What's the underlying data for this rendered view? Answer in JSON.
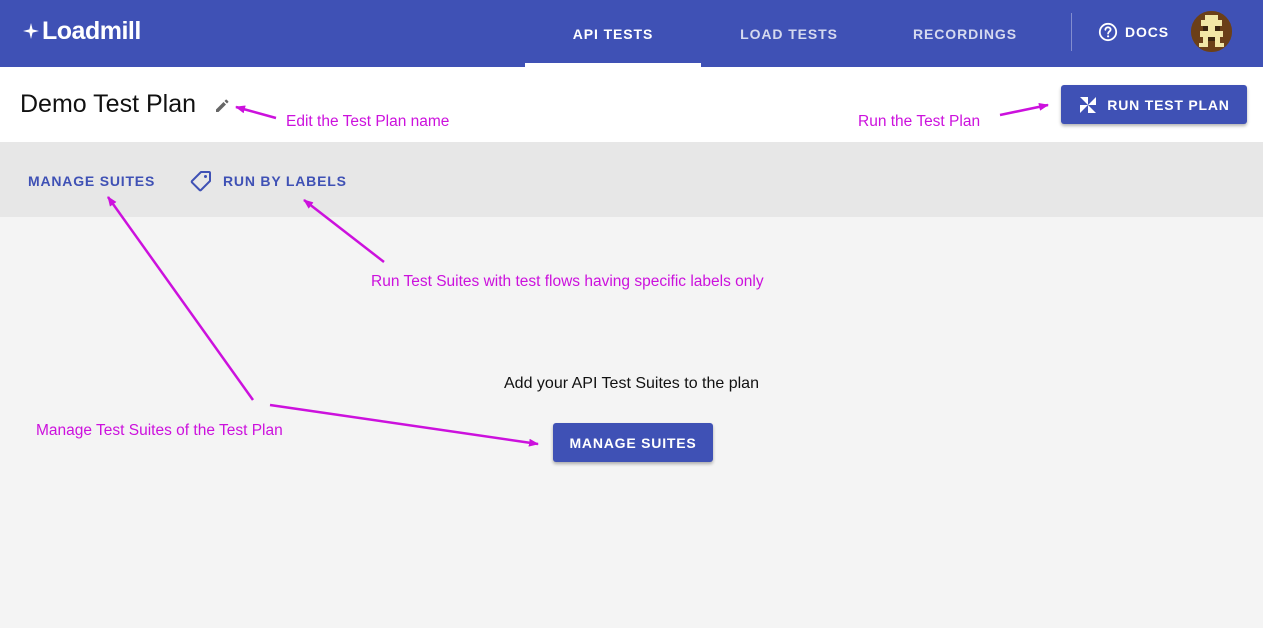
{
  "app": {
    "logo_text": "Loadmill"
  },
  "nav": {
    "tabs": [
      {
        "label": "API TESTS",
        "active": true
      },
      {
        "label": "LOAD TESTS",
        "active": false
      },
      {
        "label": "RECORDINGS",
        "active": false
      }
    ],
    "docs_label": "DOCS"
  },
  "plan": {
    "title": "Demo Test Plan",
    "run_label": "RUN TEST PLAN"
  },
  "toolbar": {
    "manage_suites_label": "MANAGE SUITES",
    "run_by_labels_label": "RUN BY LABELS"
  },
  "empty_state": {
    "message": "Add your API Test Suites to the plan",
    "manage_suites_label": "MANAGE SUITES"
  },
  "annotations": {
    "edit_name": "Edit the Test Plan name",
    "run_plan": "Run the Test Plan",
    "run_by_labels": "Run Test Suites with test flows having specific labels only",
    "manage_suites": "Manage Test Suites of the Test Plan"
  },
  "colors": {
    "primary": "#3f51b5",
    "annotation": "#cc11dd",
    "toolbar_bg": "#e7e7e7",
    "page_bg": "#f4f4f4"
  }
}
